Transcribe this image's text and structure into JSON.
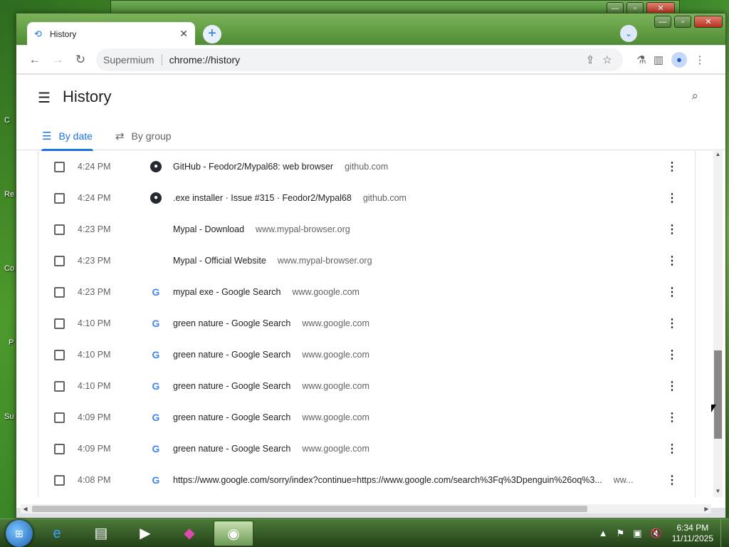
{
  "desktop": {
    "labels": [
      "C",
      "Re",
      "Co",
      "P",
      "Su"
    ]
  },
  "browser": {
    "tab": {
      "title": "History"
    },
    "toolbar": {
      "back_label": "←",
      "forward_label": "→",
      "reload_label": "↻",
      "brand": "Supermium",
      "url": "chrome://history"
    }
  },
  "history": {
    "title": "History",
    "tabs": [
      {
        "label": "By date",
        "icon": "list-icon"
      },
      {
        "label": "By group",
        "icon": "group-icon"
      }
    ],
    "rows": [
      {
        "time": "4:24 PM",
        "favicon": "github",
        "title": "GitHub - Feodor2/Mypal68: web browser",
        "domain": "github.com"
      },
      {
        "time": "4:24 PM",
        "favicon": "github",
        "title": ".exe installer · Issue #315 · Feodor2/Mypal68",
        "domain": "github.com"
      },
      {
        "time": "4:23 PM",
        "favicon": "none",
        "title": "Mypal - Download",
        "domain": "www.mypal-browser.org"
      },
      {
        "time": "4:23 PM",
        "favicon": "none",
        "title": "Mypal - Official Website",
        "domain": "www.mypal-browser.org"
      },
      {
        "time": "4:23 PM",
        "favicon": "google",
        "title": "mypal exe - Google Search",
        "domain": "www.google.com"
      },
      {
        "time": "4:10 PM",
        "favicon": "google",
        "title": "green nature - Google Search",
        "domain": "www.google.com"
      },
      {
        "time": "4:10 PM",
        "favicon": "google",
        "title": "green nature - Google Search",
        "domain": "www.google.com"
      },
      {
        "time": "4:10 PM",
        "favicon": "google",
        "title": "green nature - Google Search",
        "domain": "www.google.com"
      },
      {
        "time": "4:09 PM",
        "favicon": "google",
        "title": "green nature - Google Search",
        "domain": "www.google.com"
      },
      {
        "time": "4:09 PM",
        "favicon": "google",
        "title": "green nature - Google Search",
        "domain": "www.google.com"
      },
      {
        "time": "4:08 PM",
        "favicon": "google",
        "title": "https://www.google.com/sorry/index?continue=https://www.google.com/search%3Fq%3Dpenguin%26oq%3...",
        "domain": "ww..."
      }
    ]
  },
  "taskbar": {
    "clock_time": "6:34 PM",
    "clock_date": "11/11/2025"
  },
  "colors": {
    "accent": "#1a73e8",
    "text": "#202124",
    "muted": "#5f6368"
  }
}
